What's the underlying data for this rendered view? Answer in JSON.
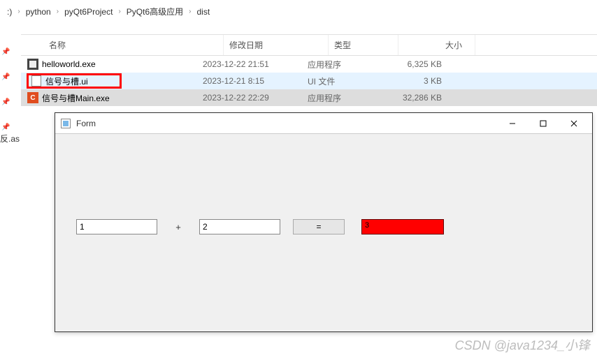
{
  "breadcrumb": {
    "segments": [
      ":)",
      "python",
      "pyQt6Project",
      "PyQt6高级应用",
      "dist"
    ]
  },
  "headers": {
    "name": "名称",
    "date": "修改日期",
    "type": "类型",
    "size": "大小"
  },
  "files": [
    {
      "name": "helloworld.exe",
      "date": "2023-12-22 21:51",
      "type": "应用程序",
      "size": "6,325 KB",
      "icon": "exe"
    },
    {
      "name": "信号与槽.ui",
      "date": "2023-12-21 8:15",
      "type": "UI 文件",
      "size": "3 KB",
      "icon": "ui",
      "highlighted": true
    },
    {
      "name": "信号与槽Main.exe",
      "date": "2023-12-22 22:29",
      "type": "应用程序",
      "size": "32,286 KB",
      "icon": "c"
    }
  ],
  "left_label": "反.as",
  "qt": {
    "title": "Form",
    "input1": "1",
    "plus": "+",
    "input2": "2",
    "equals": "=",
    "result": "3"
  },
  "watermark": "CSDN @java1234_小锋"
}
